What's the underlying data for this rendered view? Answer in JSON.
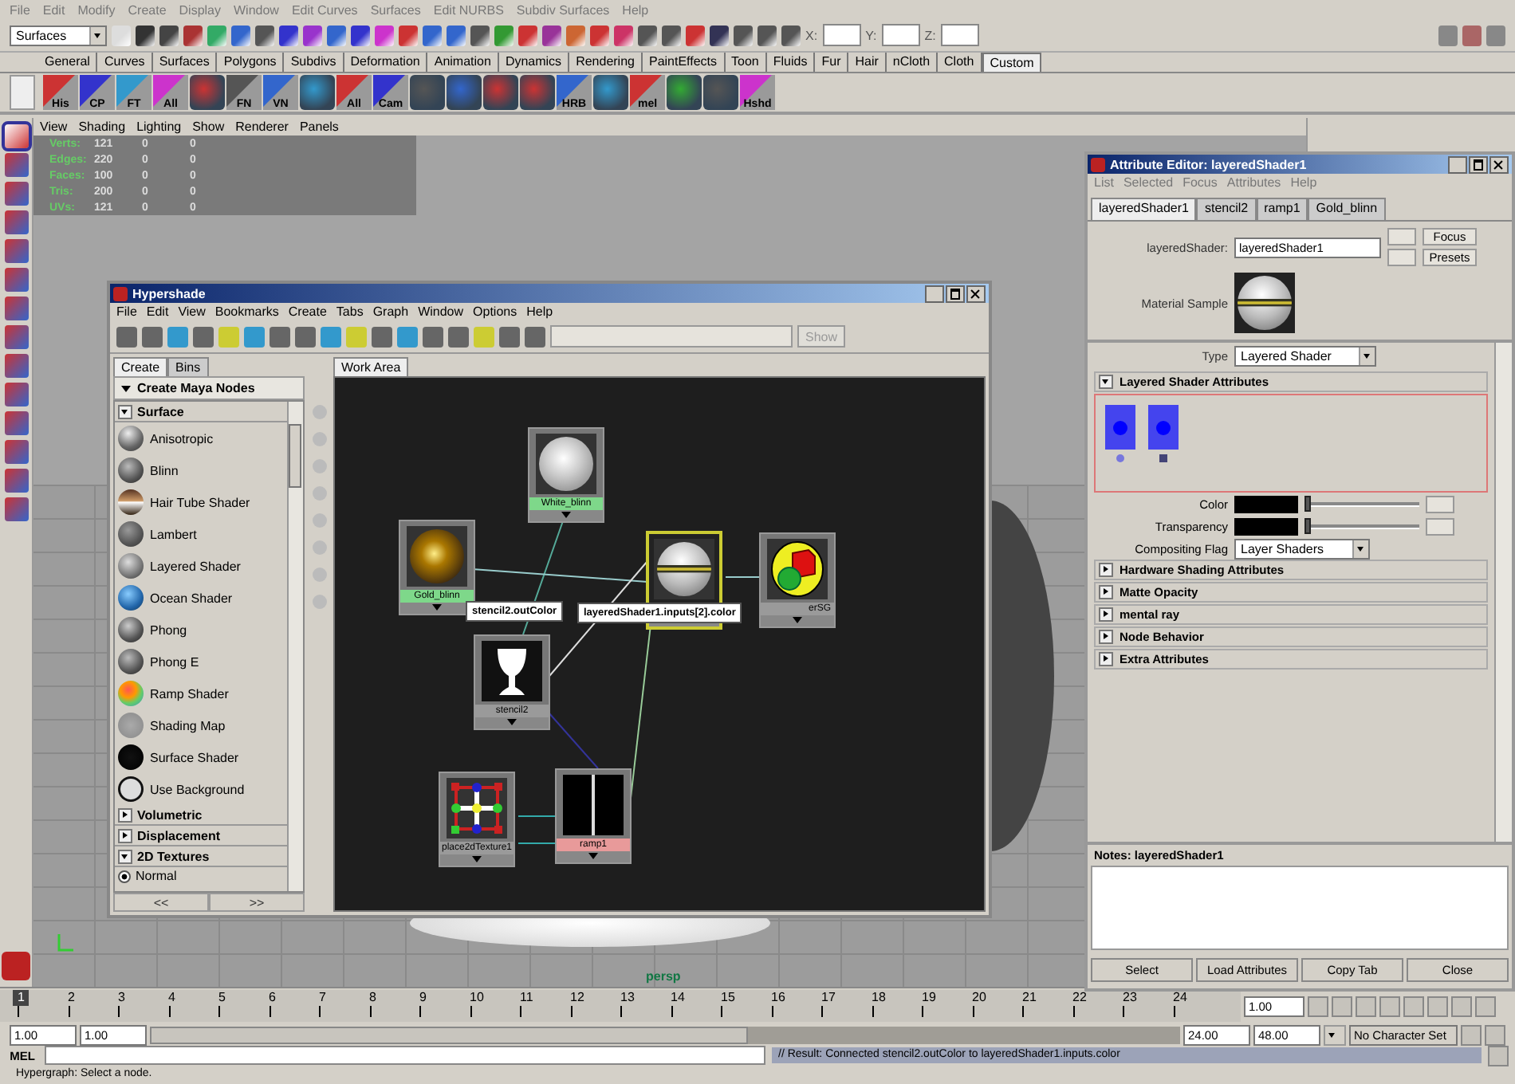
{
  "menubar": [
    "File",
    "Edit",
    "Modify",
    "Create",
    "Display",
    "Window",
    "Edit Curves",
    "Surfaces",
    "Edit NURBS",
    "Subdiv Surfaces",
    "Help"
  ],
  "status_line": {
    "menu_set": "Surfaces",
    "coord_labels": [
      "X:",
      "Y:",
      "Z:"
    ]
  },
  "shelf_tabs": [
    {
      "label": "General",
      "selected": false
    },
    {
      "label": "Curves",
      "selected": false
    },
    {
      "label": "Surfaces",
      "selected": false
    },
    {
      "label": "Polygons",
      "selected": false
    },
    {
      "label": "Subdivs",
      "selected": false
    },
    {
      "label": "Deformation",
      "selected": false
    },
    {
      "label": "Animation",
      "selected": false
    },
    {
      "label": "Dynamics",
      "selected": false
    },
    {
      "label": "Rendering",
      "selected": false
    },
    {
      "label": "PaintEffects",
      "selected": false
    },
    {
      "label": "Toon",
      "selected": false
    },
    {
      "label": "Fluids",
      "selected": false
    },
    {
      "label": "Fur",
      "selected": false
    },
    {
      "label": "Hair",
      "selected": false
    },
    {
      "label": "nCloth",
      "selected": false
    },
    {
      "label": "Cloth",
      "selected": false
    },
    {
      "label": "Custom",
      "selected": true
    }
  ],
  "shelf_buttons": [
    {
      "kind": "labeled",
      "label": "His"
    },
    {
      "kind": "labeled",
      "label": "CP"
    },
    {
      "kind": "labeled",
      "label": "FT"
    },
    {
      "kind": "labeled",
      "label": "All"
    },
    {
      "kind": "icon"
    },
    {
      "kind": "labeled",
      "label": "FN"
    },
    {
      "kind": "labeled",
      "label": "VN"
    },
    {
      "kind": "icon"
    },
    {
      "kind": "labeled",
      "label": "All"
    },
    {
      "kind": "labeled",
      "label": "Cam"
    },
    {
      "kind": "icon"
    },
    {
      "kind": "icon"
    },
    {
      "kind": "icon"
    },
    {
      "kind": "icon"
    },
    {
      "kind": "labeled",
      "label": "HRB"
    },
    {
      "kind": "icon"
    },
    {
      "kind": "labeled",
      "label": "mel"
    },
    {
      "kind": "icon"
    },
    {
      "kind": "icon"
    },
    {
      "kind": "labeled",
      "label": "Hshd"
    }
  ],
  "viewport": {
    "panel_menu": [
      "View",
      "Shading",
      "Lighting",
      "Show",
      "Renderer",
      "Panels"
    ],
    "stats": [
      {
        "label": "Verts:",
        "values": [
          "121",
          "0",
          "0"
        ]
      },
      {
        "label": "Edges:",
        "values": [
          "220",
          "0",
          "0"
        ]
      },
      {
        "label": "Faces:",
        "values": [
          "100",
          "0",
          "0"
        ]
      },
      {
        "label": "Tris:",
        "values": [
          "200",
          "0",
          "0"
        ]
      },
      {
        "label": "UVs:",
        "values": [
          "121",
          "0",
          "0"
        ]
      }
    ],
    "camera": "persp"
  },
  "hypershade": {
    "title": "Hypershade",
    "menu": [
      "File",
      "Edit",
      "View",
      "Bookmarks",
      "Create",
      "Tabs",
      "Graph",
      "Window",
      "Options",
      "Help"
    ],
    "show_button": "Show",
    "tabs": [
      {
        "label": "Create",
        "selected": true
      },
      {
        "label": "Bins",
        "selected": false
      }
    ],
    "create_header": "Create Maya Nodes",
    "sections": [
      {
        "label": "Surface",
        "expanded": true,
        "items": [
          "Anisotropic",
          "Blinn",
          "Hair Tube Shader",
          "Lambert",
          "Layered Shader",
          "Ocean Shader",
          "Phong",
          "Phong E",
          "Ramp Shader",
          "Shading Map",
          "Surface Shader",
          "Use Background"
        ]
      },
      {
        "label": "Volumetric",
        "expanded": false
      },
      {
        "label": "Displacement",
        "expanded": false
      },
      {
        "label": "2D Textures",
        "expanded": true,
        "options": [
          {
            "label": "Normal",
            "selected": true
          }
        ]
      }
    ],
    "scroll_buttons": [
      "<<",
      ">>"
    ],
    "work_area_tab": "Work Area",
    "nodes": [
      {
        "kind": "white_sphere",
        "name": "White_blinn",
        "color": "#7ed88a",
        "selected": false
      },
      {
        "kind": "gold_sphere",
        "name": "Gold_blinn",
        "color": "#7ed88a",
        "selected": false
      },
      {
        "kind": "stencil",
        "name": "stencil2",
        "color": "#9a9a9a",
        "selected": false
      },
      {
        "kind": "place2d",
        "name": "place2dTexture1",
        "color": "#9a9a9a",
        "selected": false
      },
      {
        "kind": "ramp",
        "name": "ramp1",
        "color": "#e89a9a",
        "selected": false
      },
      {
        "kind": "layered",
        "selected": true
      },
      {
        "kind": "shading_group",
        "name": "erSG",
        "color": "#9a9a9a",
        "selected": false
      }
    ],
    "tooltips": [
      "stencil2.outColor",
      "layeredShader1.inputs[2].color"
    ]
  },
  "attribute_editor": {
    "title": "Attribute Editor: layeredShader1",
    "menu": [
      "List",
      "Selected",
      "Focus",
      "Attributes",
      "Help"
    ],
    "tabs": [
      {
        "label": "layeredShader1",
        "selected": true
      },
      {
        "label": "stencil2",
        "selected": false
      },
      {
        "label": "ramp1",
        "selected": false
      },
      {
        "label": "Gold_blinn",
        "selected": false
      }
    ],
    "node_label": "layeredShader:",
    "node_value": "layeredShader1",
    "side_buttons": [
      "Focus",
      "Presets"
    ],
    "sample_label": "Material Sample",
    "type_label": "Type",
    "type_value": "Layered Shader",
    "sections": [
      {
        "label": "Layered Shader Attributes",
        "expanded": true
      },
      {
        "label": "Hardware Shading Attributes",
        "expanded": false
      },
      {
        "label": "Matte Opacity",
        "expanded": false
      },
      {
        "label": "mental ray",
        "expanded": false
      },
      {
        "label": "Node Behavior",
        "expanded": false
      },
      {
        "label": "Extra Attributes",
        "expanded": false
      }
    ],
    "attributes": [
      {
        "kind": "slider",
        "label": "Color",
        "level": 0
      },
      {
        "kind": "slider",
        "label": "Transparency",
        "level": 0
      },
      {
        "kind": "dropdown",
        "label": "Compositing Flag",
        "value": "Layer Shaders"
      }
    ],
    "notes_label": "Notes:  layeredShader1",
    "buttons": [
      "Select",
      "Load Attributes",
      "Copy Tab",
      "Close"
    ]
  },
  "timeline": {
    "frames": [
      {
        "label": "1",
        "selected": true
      },
      {
        "label": "2",
        "selected": false
      },
      {
        "label": "3",
        "selected": false
      },
      {
        "label": "4",
        "selected": false
      },
      {
        "label": "5",
        "selected": false
      },
      {
        "label": "6",
        "selected": false
      },
      {
        "label": "7",
        "selected": false
      },
      {
        "label": "8",
        "selected": false
      },
      {
        "label": "9",
        "selected": false
      },
      {
        "label": "10",
        "selected": false
      },
      {
        "label": "11",
        "selected": false
      },
      {
        "label": "12",
        "selected": false
      },
      {
        "label": "13",
        "selected": false
      },
      {
        "label": "14",
        "selected": false
      },
      {
        "label": "15",
        "selected": false
      },
      {
        "label": "16",
        "selected": false
      },
      {
        "label": "17",
        "selected": false
      },
      {
        "label": "18",
        "selected": false
      },
      {
        "label": "19",
        "selected": false
      },
      {
        "label": "20",
        "selected": false
      },
      {
        "label": "21",
        "selected": false
      },
      {
        "label": "22",
        "selected": false
      },
      {
        "label": "23",
        "selected": false
      },
      {
        "label": "24",
        "selected": false
      }
    ],
    "current_frame": "1.00"
  },
  "range_slider": {
    "level": 0.58,
    "start": "1.00",
    "range_start": "1.00",
    "range_end": "24.00",
    "end": "48.00",
    "character_set": "No Character Set"
  },
  "command_line": {
    "label": "MEL",
    "result": "// Result: Connected stencil2.outColor to layeredShader1.inputs.color"
  },
  "help_line": "Hypergraph: Select a node."
}
